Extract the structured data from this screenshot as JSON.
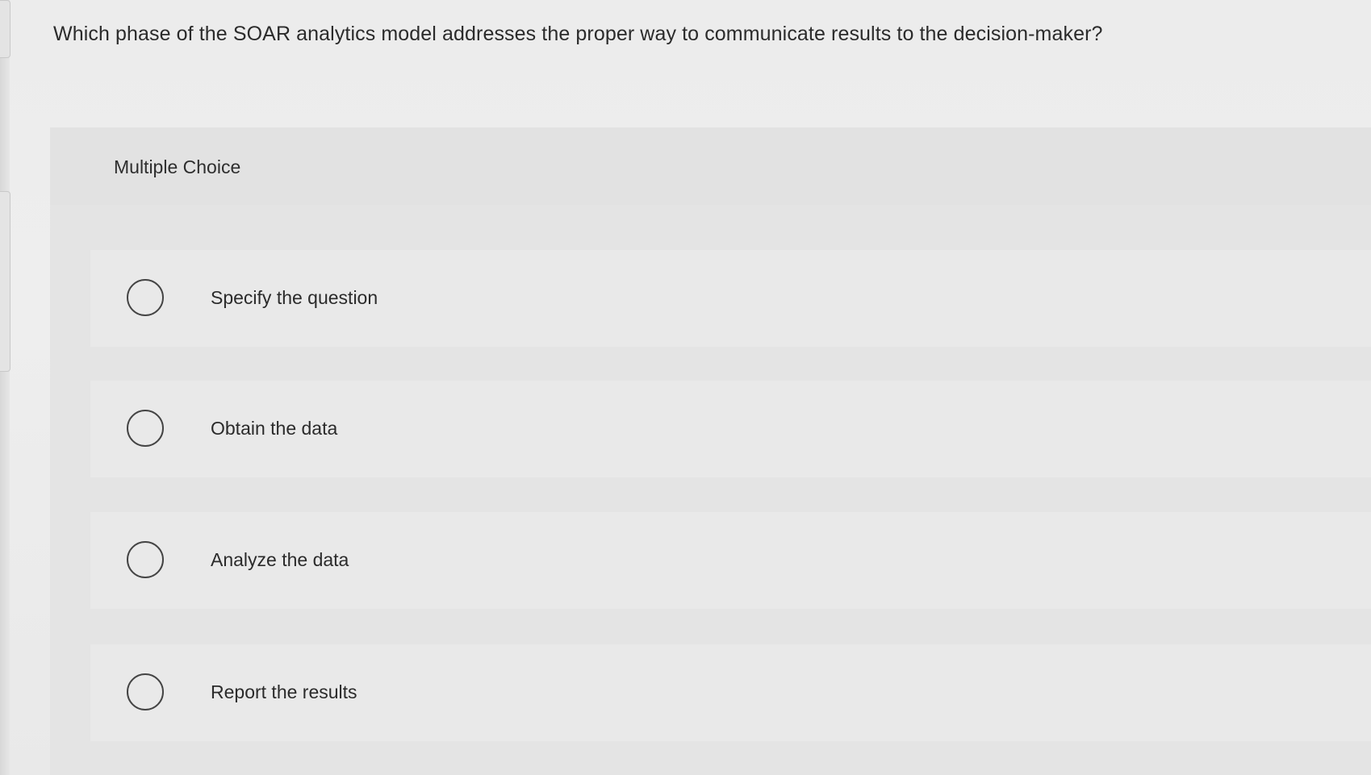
{
  "question": {
    "text": "Which phase of the SOAR analytics model addresses the proper way to communicate results to the decision-maker?"
  },
  "multiple_choice": {
    "label": "Multiple Choice",
    "options": [
      {
        "label": "Specify the question",
        "selected": false
      },
      {
        "label": "Obtain the data",
        "selected": false
      },
      {
        "label": "Analyze the data",
        "selected": false
      },
      {
        "label": "Report the results",
        "selected": false
      }
    ]
  }
}
